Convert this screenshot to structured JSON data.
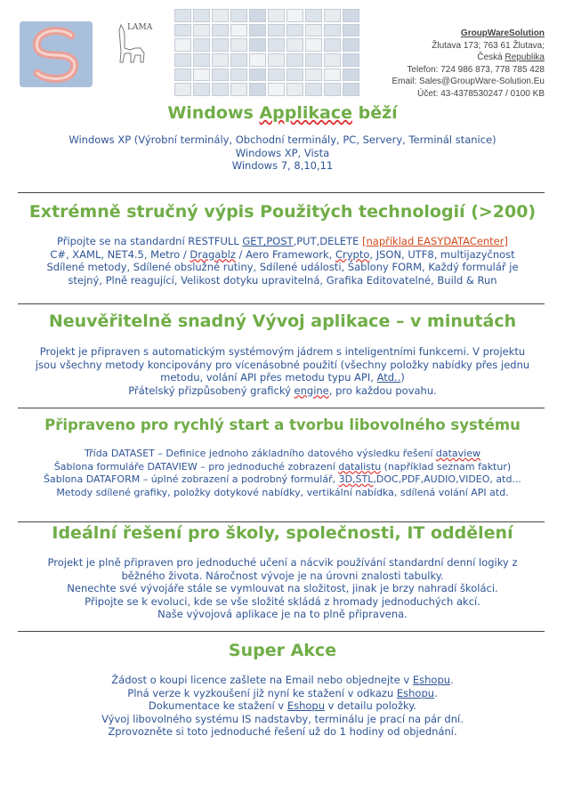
{
  "header": {
    "company_name": "GroupWareSolution",
    "address_line1": "Žlutava 173; 763 61 Žlutava;",
    "address_line2_a": "Česká ",
    "address_line2_b": "Republika",
    "phone": "Telefon: 724 986 873, 778 785 428",
    "email": "Email: Sales@GroupWare-Solution.Eu",
    "account": "Účet: 43-4378530247 / 0100 KB",
    "lama_text": "LAMA"
  },
  "sections": [
    {
      "title_a": "Windows ",
      "title_b": "Applikace",
      "title_c": " běží",
      "lines": [
        "Windows XP (Výrobní terminály, Obchodní terminály, PC, Servery, Terminál stanice)",
        "Windows XP, Vista",
        "Windows 7, 8,10,11"
      ]
    },
    {
      "title": "Extrémně stručný výpis Použitých technologií (>200)",
      "l1_a": "Připojte se na standardní RESTFULL ",
      "l1_b": "GET,POST",
      "l1_c": ",PUT,DELETE ",
      "l1_d": "[například EASYDATACenter]",
      "l2_a": "C#, XAML, NET4.5, Metro / ",
      "l2_b": "Dragablz",
      "l2_c": " / Aero Framework, ",
      "l2_d": "Crypto",
      "l2_e": ", JSON, UTF8, multijazyčnost",
      "l3": "Sdílené metody, Sdílené obslužné rutiny, Sdílené události, Šablony FORM, Každý formulář je",
      "l4": "stejný, Plně reagující, Velikost dotyku upravitelná, Grafika Editovatelné, Build & Run"
    },
    {
      "title": "Neuvěřitelně snadný Vývoj aplikace – v minutách",
      "l1": "Projekt je připraven s automatickým systémovým jádrem s inteligentními funkcemi. V projektu",
      "l2": "jsou všechny metody koncipovány pro vícenásobné použití (všechny položky nabídky přes jednu",
      "l3_a": "metodu, volání API přes metodu typu API, ",
      "l3_b": "Atd..",
      "l3_c": ")",
      "l4_a": "Přátelský přizpůsobený grafický ",
      "l4_b": "engine",
      "l4_c": ", pro každou povahu."
    },
    {
      "title": "Připraveno pro rychlý start a tvorbu libovolného systému",
      "l1_a": "Třída DATASET – Definice jednoho základního datového výsledku řešení ",
      "l1_b": "dataview",
      "l2_a": "Šablona formuláře DATAVIEW – pro jednoduché zobrazení ",
      "l2_b": "datalistu",
      "l2_c": " (například seznam faktur)",
      "l3_a": "Šablona DATAFORM – úplné zobrazení a podrobný formulář, ",
      "l3_b": "3D,STL",
      "l3_c": ",DOC,PDF,AUDIO,VIDEO, atd...",
      "l4": "Metody sdílené grafiky, položky dotykové nabídky, vertikální nabídka, sdílená volání API atd."
    },
    {
      "title": "Ideální řešení pro školy, společnosti, IT oddělení",
      "l1": "Projekt je plně připraven pro jednoduché učení a nácvik používání standardní denní logiky z",
      "l2": "běžného života. Náročnost vývoje je na úrovni znalosti tabulky.",
      "l3": "Nenechte své vývojáře stále se vymlouvat na složitost, jinak je brzy nahradí školáci.",
      "l4": "Připojte se k evoluci, kde se vše složité skládá z hromady jednoduchých akcí.",
      "l5": "Naše vývojová aplikace je na to plně připravena."
    },
    {
      "title": "Super Akce",
      "l1_a": "Žádost o koupi licence zašlete na Email nebo objednejte v ",
      "l1_b": "Eshopu",
      "l1_c": ".",
      "l2_a": "Plná verze k vyzkoušení již nyní ke stažení v odkazu ",
      "l2_b": "Eshopu",
      "l2_c": ".",
      "l3_a": "Dokumentace ke stažení v ",
      "l3_b": "Eshopu",
      "l3_c": " v detailu položky.",
      "l4": "Vývoj libovolného systému IS nadstavby, terminálu je prací na pár dní.",
      "l5": "Zprovozněte si toto jednoduché řešení už do 1 hodiny od objednání."
    }
  ],
  "colors": {
    "heading": "#70ad47",
    "body_text": "#2f5597",
    "accent_red": "#d04a1c"
  }
}
